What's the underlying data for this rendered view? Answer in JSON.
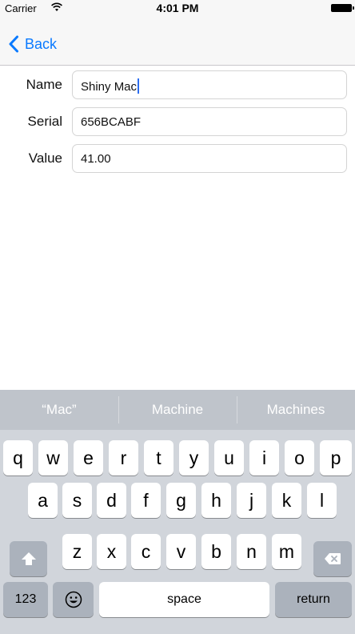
{
  "status_bar": {
    "carrier": "Carrier",
    "time": "4:01 PM",
    "icons": [
      "wifi-icon",
      "battery-icon"
    ]
  },
  "nav": {
    "back_label": "Back",
    "back_icon": "chevron-left-icon",
    "accent_color": "#0a7aff"
  },
  "form": {
    "name": {
      "label": "Name",
      "value": "Shiny Mac"
    },
    "serial": {
      "label": "Serial",
      "value": "656BCABF"
    },
    "value": {
      "label": "Value",
      "value": "41.00"
    }
  },
  "keyboard": {
    "suggestions": [
      "“Mac”",
      "Machine",
      "Machines"
    ],
    "row1": [
      "q",
      "w",
      "e",
      "r",
      "t",
      "y",
      "u",
      "i",
      "o",
      "p"
    ],
    "row2": [
      "a",
      "s",
      "d",
      "f",
      "g",
      "h",
      "j",
      "k",
      "l"
    ],
    "row3": [
      "z",
      "x",
      "c",
      "v",
      "b",
      "n",
      "m"
    ],
    "numbers_label": "123",
    "space_label": "space",
    "return_label": "return",
    "icons": [
      "shift-icon",
      "delete-icon",
      "emoji-icon"
    ]
  }
}
